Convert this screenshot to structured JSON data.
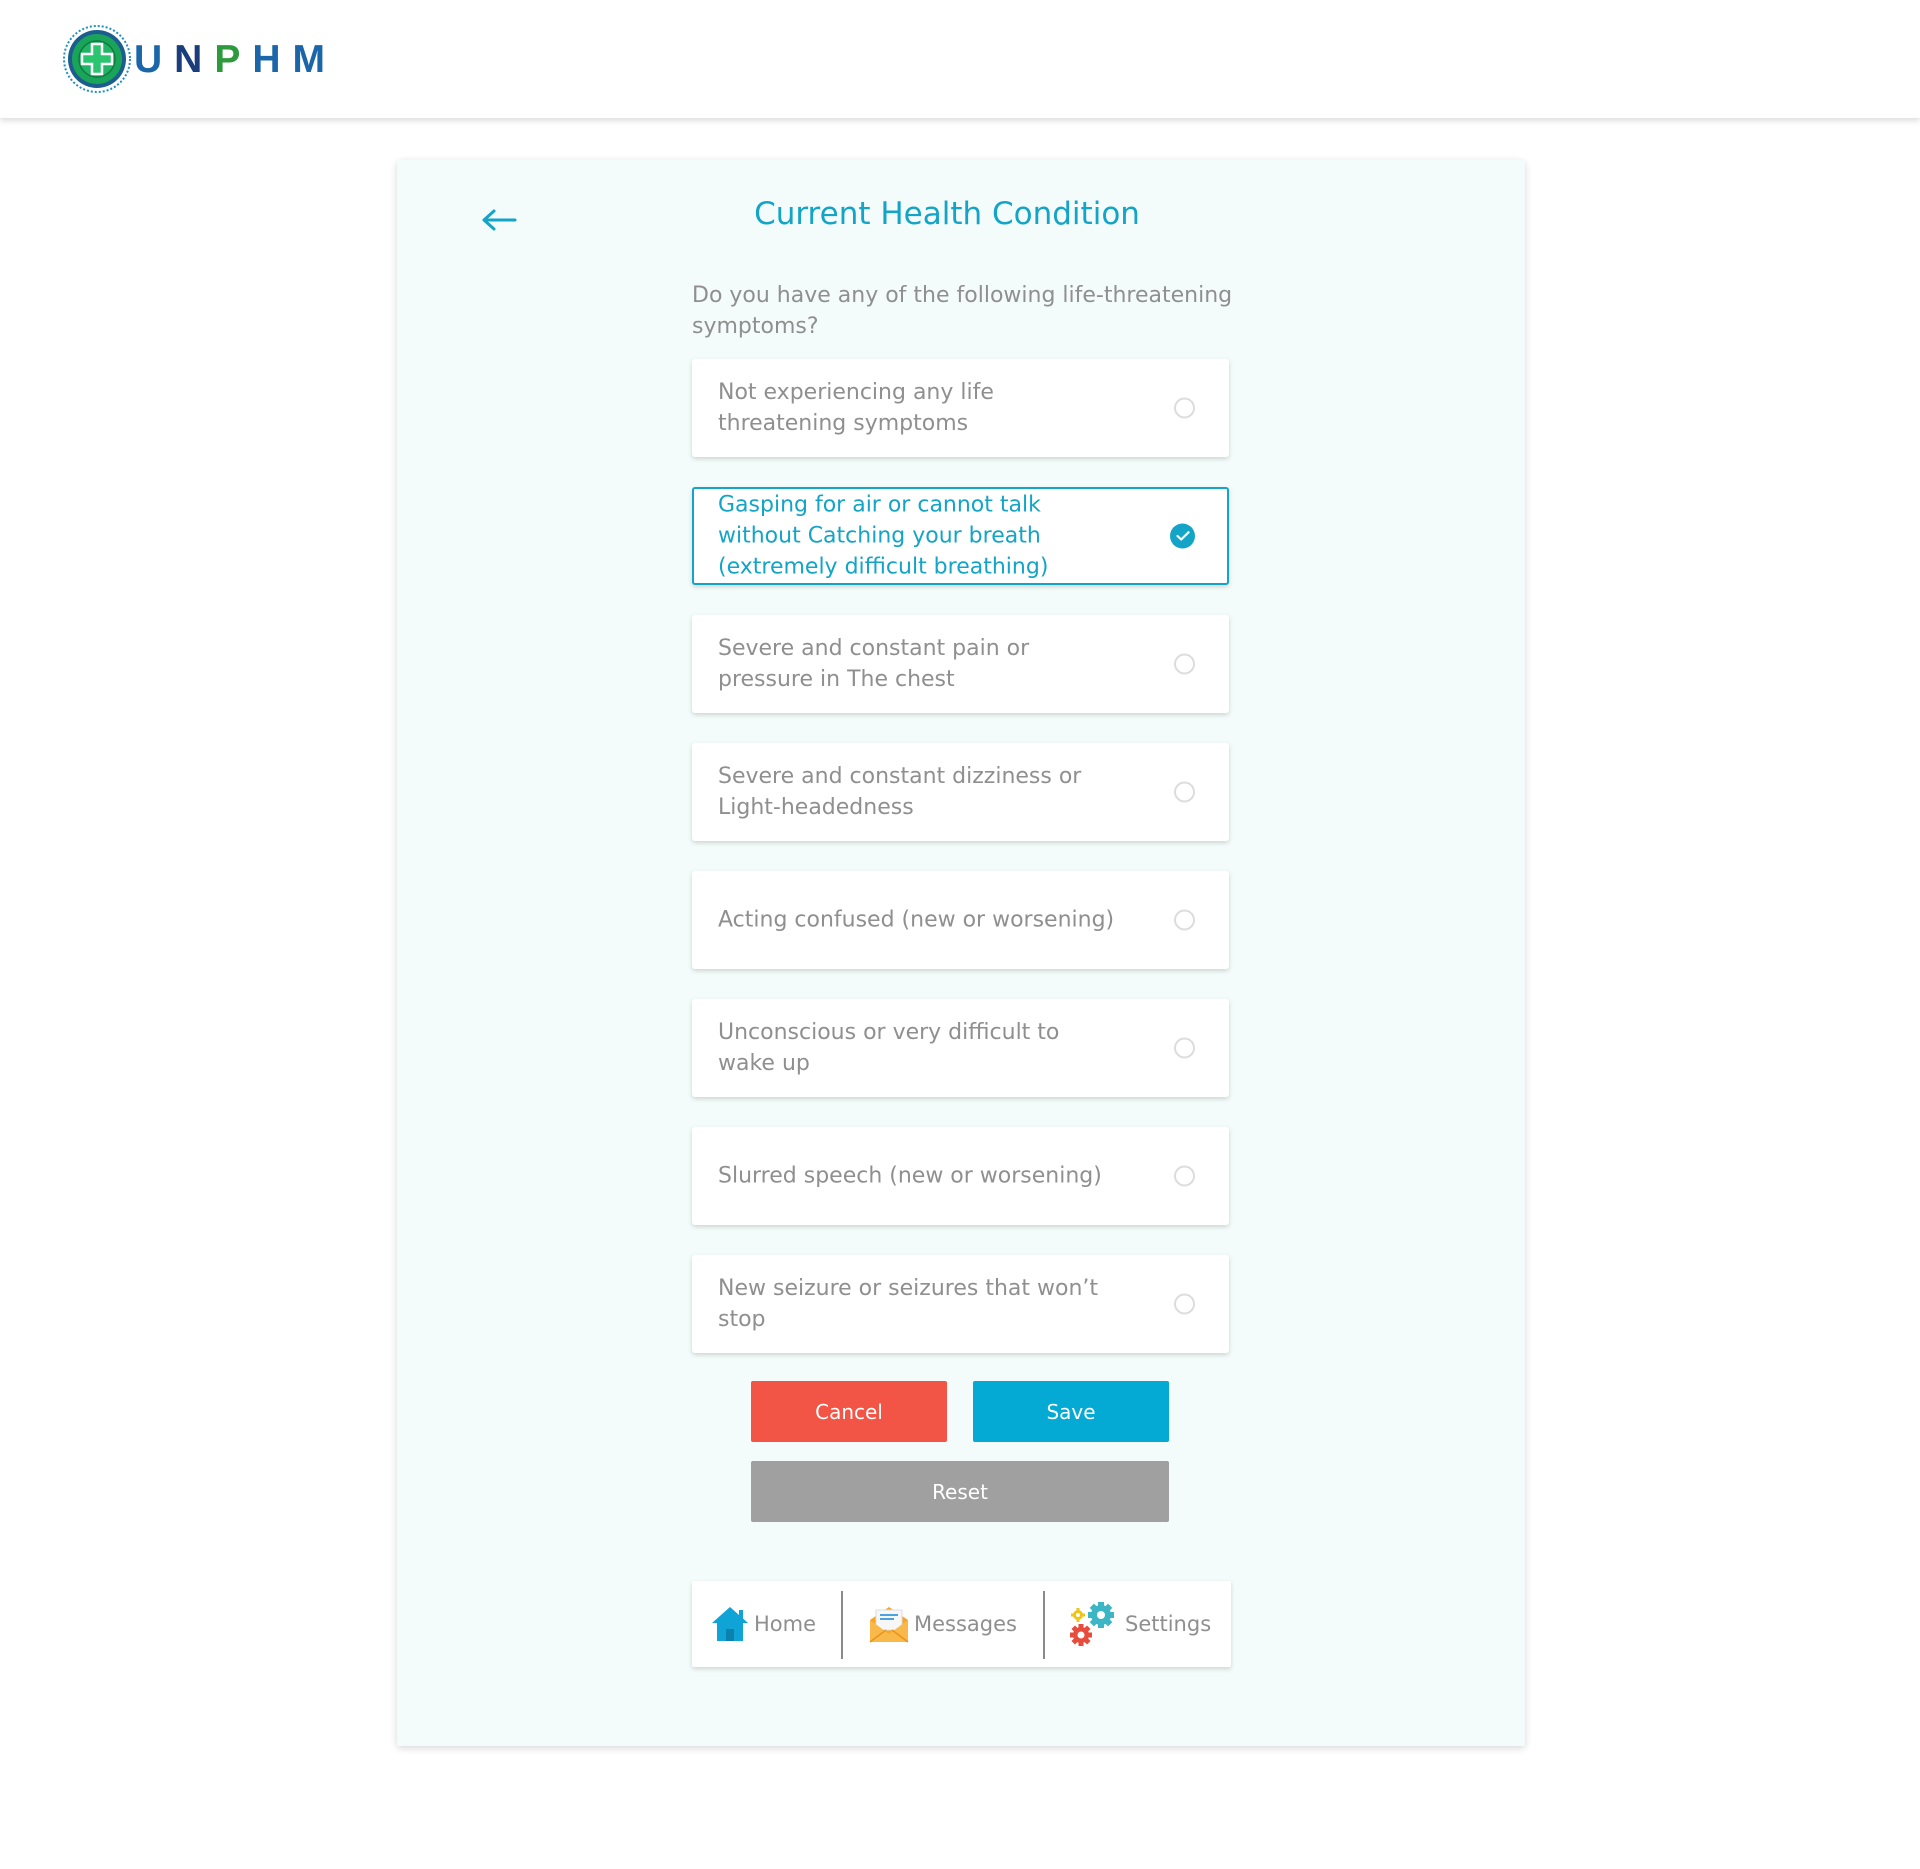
{
  "header": {
    "logo_text": [
      "U",
      "N",
      "P",
      "H",
      "M"
    ],
    "logo_colors": [
      "#1a66a8",
      "#1a3e7c",
      "#2f9a3d",
      "#1a66a8",
      "#1a66a8"
    ],
    "logo_icon": "medical-cross-icon"
  },
  "page": {
    "back_icon": "arrow-left-icon",
    "title": "Current Health Condition",
    "question": "Do you have any of the following life-threatening symptoms?"
  },
  "options": [
    {
      "label": "Not experiencing any life threatening symptoms",
      "selected": false
    },
    {
      "label": "Gasping for air or cannot talk without Catching your breath (extremely difficult breathing)",
      "selected": true
    },
    {
      "label": "Severe and constant pain or pressure in The chest",
      "selected": false
    },
    {
      "label": "Severe and constant dizziness or Light-headedness",
      "selected": false
    },
    {
      "label": "Acting confused (new or worsening)",
      "selected": false
    },
    {
      "label": "Unconscious or very difficult to wake up",
      "selected": false
    },
    {
      "label": "Slurred speech (new or worsening)",
      "selected": false
    },
    {
      "label": "New seizure or seizures that won’t stop",
      "selected": false
    }
  ],
  "buttons": {
    "cancel": "Cancel",
    "save": "Save",
    "reset": "Reset"
  },
  "nav": {
    "home": {
      "label": "Home",
      "icon": "home-icon"
    },
    "messages": {
      "label": "Messages",
      "icon": "envelope-icon"
    },
    "settings": {
      "label": "Settings",
      "icon": "gears-icon"
    }
  },
  "colors": {
    "accent": "#13a4c7",
    "cancel": "#f25446",
    "save": "#04aad4",
    "reset": "#a0a0a0",
    "card_bg": "#f4fcfb"
  }
}
